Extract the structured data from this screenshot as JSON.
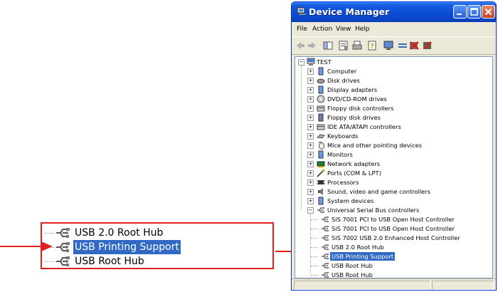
{
  "window": {
    "title": "Device Manager",
    "buttons": [
      "minimize",
      "maximize",
      "close"
    ]
  },
  "menu": [
    "File",
    "Action",
    "View",
    "Help"
  ],
  "toolbar_icons": [
    "back-arrow-icon",
    "forward-arrow-icon",
    "console-tree-icon",
    "properties-icon",
    "print-icon",
    "help-icon",
    "scan-hardware-icon",
    "update-driver-icon",
    "uninstall-icon",
    "disable-icon"
  ],
  "tree": {
    "root": "TEST",
    "categories": [
      {
        "label": "Computer",
        "icon": "computer-icon"
      },
      {
        "label": "Disk drives",
        "icon": "disk-drive-icon"
      },
      {
        "label": "Display adapters",
        "icon": "display-adapter-icon"
      },
      {
        "label": "DVD/CD-ROM drives",
        "icon": "dvd-drive-icon"
      },
      {
        "label": "Floppy disk controllers",
        "icon": "floppy-controller-icon"
      },
      {
        "label": "Floppy disk drives",
        "icon": "floppy-drive-icon"
      },
      {
        "label": "IDE ATA/ATAPI controllers",
        "icon": "ide-controller-icon"
      },
      {
        "label": "Keyboards",
        "icon": "keyboard-icon"
      },
      {
        "label": "Mice and other pointing devices",
        "icon": "mouse-icon"
      },
      {
        "label": "Monitors",
        "icon": "monitor-icon"
      },
      {
        "label": "Network adapters",
        "icon": "network-adapter-icon"
      },
      {
        "label": "Ports (COM & LPT)",
        "icon": "port-icon"
      },
      {
        "label": "Processors",
        "icon": "processor-icon"
      },
      {
        "label": "Sound, video and game controllers",
        "icon": "sound-icon"
      },
      {
        "label": "System devices",
        "icon": "system-device-icon"
      },
      {
        "label": "Universal Serial Bus controllers",
        "icon": "usb-icon"
      }
    ],
    "usb_children": [
      "SiS 7001 PCI to USB Open Host Controller",
      "SiS 7001 PCI to USB Open Host Controller",
      "SiS 7002 USB 2.0 Enhanced Host Controller",
      "USB 2.0 Root Hub",
      "USB Printing Support",
      "USB Root Hub",
      "USB Root Hub"
    ],
    "selected": "USB Printing Support"
  },
  "callout": {
    "items": [
      "USB 2.0 Root Hub",
      "USB Printing Support",
      "USB Root Hub"
    ],
    "selected_index": 1
  },
  "colors": {
    "titlebar": "#0a4fd8",
    "selection": "#316ac5",
    "callout_border": "#e02020",
    "arrow": "#e02020"
  }
}
